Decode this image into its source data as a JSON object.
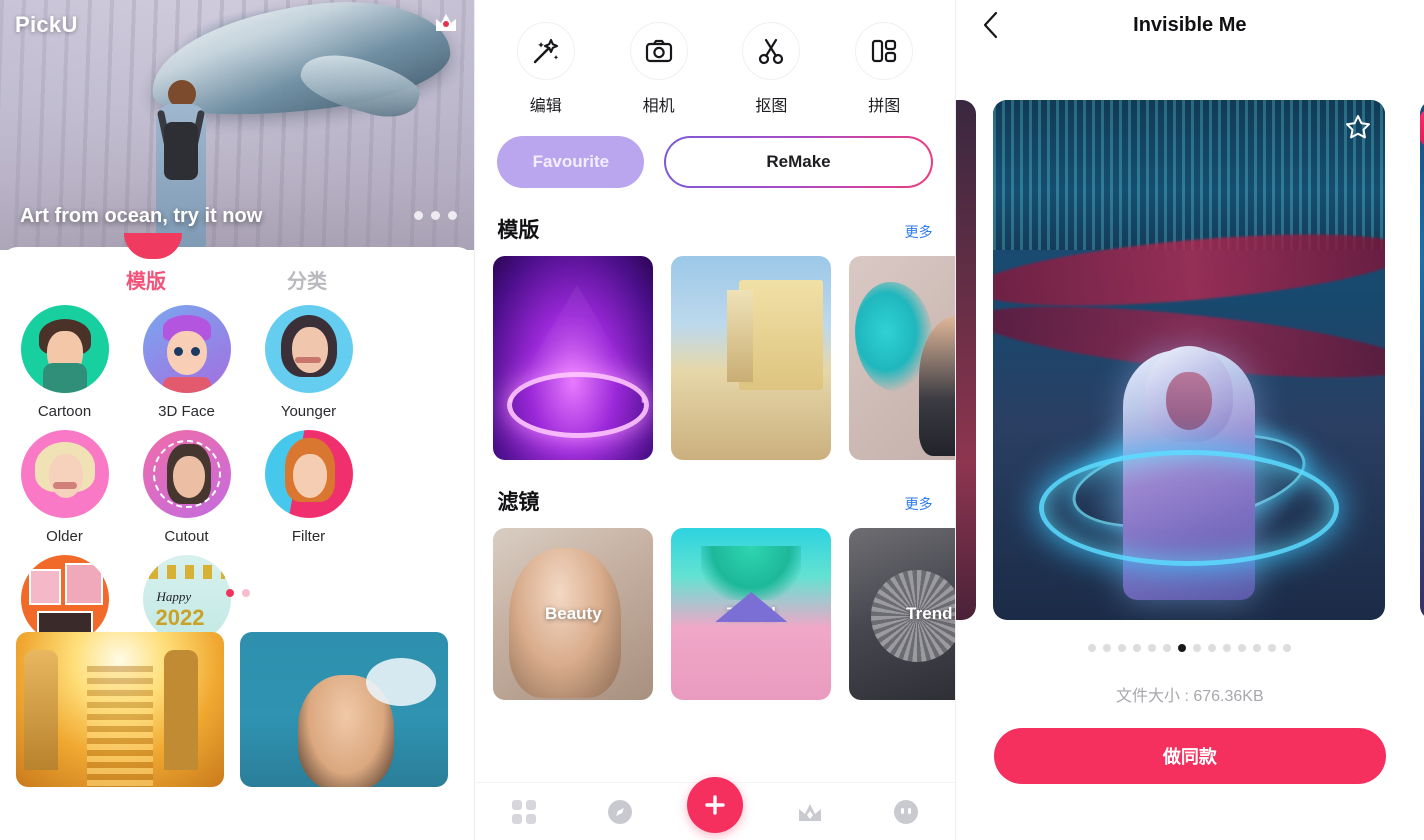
{
  "panel1": {
    "app_name": "PickU",
    "banner": {
      "caption": "Art from ocean, try it now",
      "crown_icon": "crown-icon",
      "dots": 3
    },
    "tabs": [
      {
        "label": "模版",
        "active": true
      },
      {
        "label": "分类",
        "active": false
      }
    ],
    "categories": [
      {
        "label": "Cartoon"
      },
      {
        "label": "3D Face"
      },
      {
        "label": "Younger"
      },
      {
        "label": "Older"
      },
      {
        "label": "Cutout"
      },
      {
        "label": "Filter"
      },
      {
        "label": "Collage"
      },
      {
        "label": "Sticker"
      }
    ],
    "category_pager": {
      "count": 2,
      "active_index": 0
    },
    "nav": [
      {
        "name": "grid",
        "active": true
      },
      {
        "name": "compass",
        "active": false
      },
      {
        "name": "plus",
        "active": false
      },
      {
        "name": "crown",
        "active": false
      },
      {
        "name": "face",
        "active": false
      }
    ]
  },
  "panel2": {
    "tools": [
      {
        "label": "编辑",
        "icon": "magic-wand-icon"
      },
      {
        "label": "相机",
        "icon": "camera-icon"
      },
      {
        "label": "抠图",
        "icon": "scissors-icon"
      },
      {
        "label": "拼图",
        "icon": "collage-layout-icon"
      }
    ],
    "pills": {
      "favourite": "Favourite",
      "remake": "ReMake"
    },
    "sections": [
      {
        "title": "模版",
        "more": "更多",
        "cards": [
          {
            "name": "neon-triangle-template"
          },
          {
            "name": "cuba-car-template"
          },
          {
            "name": "paint-splash-template"
          }
        ]
      },
      {
        "title": "滤镜",
        "more": "更多",
        "cards": [
          {
            "label": "Beauty"
          },
          {
            "label": "Travel"
          },
          {
            "label": "Trend"
          }
        ]
      }
    ],
    "nav": [
      {
        "name": "grid",
        "active": false
      },
      {
        "name": "compass",
        "active": false
      },
      {
        "name": "plus",
        "active": true
      },
      {
        "name": "crown",
        "active": false
      },
      {
        "name": "face",
        "active": false
      }
    ]
  },
  "panel3": {
    "back_icon": "back-chevron-icon",
    "title": "Invisible Me",
    "favorite_icon": "star-outline-icon",
    "pager": {
      "count": 14,
      "active_index": 6
    },
    "file_size": "文件大小 : 676.36KB",
    "cta": "做同款"
  },
  "colors": {
    "accent_pink": "#f5305f",
    "tab_active": "#f2537a",
    "link_blue": "#2e7bf0",
    "favourite_purple": "#b9a6ef",
    "remake_gradient_start": "#7b5bd6",
    "remake_gradient_end": "#ef3b7e"
  }
}
